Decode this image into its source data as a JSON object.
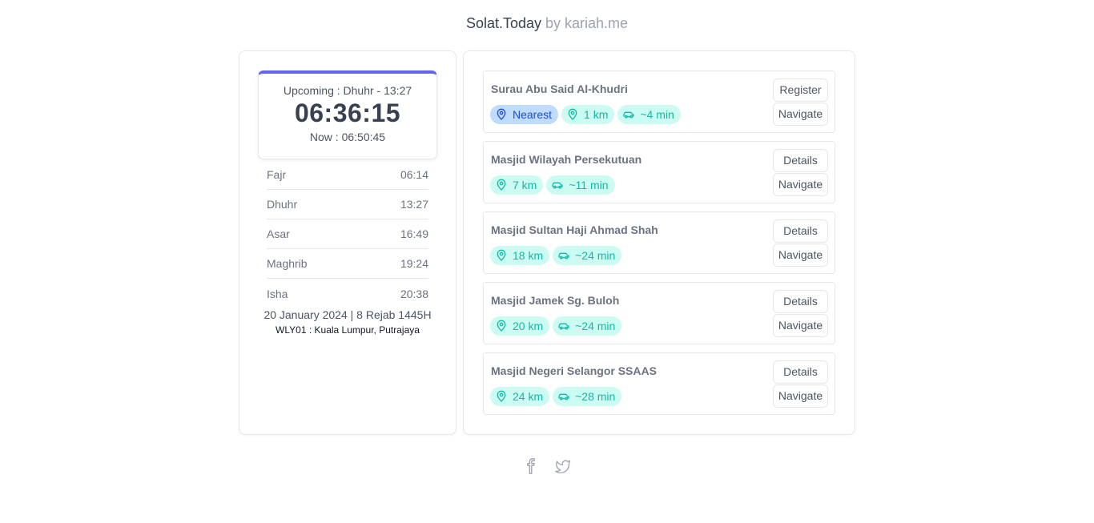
{
  "header": {
    "brand": "Solat.Today",
    "byline": "by kariah.me"
  },
  "countdown": {
    "upcoming": "Upcoming : Dhuhr - 13:27",
    "timer": "06:36:15",
    "now": "Now : 06:50:45"
  },
  "prayers": [
    {
      "name": "Fajr",
      "time": "06:14"
    },
    {
      "name": "Dhuhr",
      "time": "13:27"
    },
    {
      "name": "Asar",
      "time": "16:49"
    },
    {
      "name": "Maghrib",
      "time": "19:24"
    },
    {
      "name": "Isha",
      "time": "20:38"
    }
  ],
  "date_line": "20 January 2024 | 8 Rejab 1445H",
  "zone_line": "WLY01 : Kuala Lumpur, Putrajaya",
  "mosques": [
    {
      "name": "Surau Abu Said Al-Khudri",
      "nearest_label": "Nearest",
      "distance": "1 km",
      "drive": "~4 min",
      "primary_button": "Register",
      "navigate_button": "Navigate"
    },
    {
      "name": "Masjid Wilayah Persekutuan",
      "distance": "7 km",
      "drive": "~11 min",
      "primary_button": "Details",
      "navigate_button": "Navigate"
    },
    {
      "name": "Masjid Sultan Haji Ahmad Shah",
      "distance": "18 km",
      "drive": "~24 min",
      "primary_button": "Details",
      "navigate_button": "Navigate"
    },
    {
      "name": "Masjid Jamek Sg. Buloh",
      "distance": "20 km",
      "drive": "~24 min",
      "primary_button": "Details",
      "navigate_button": "Navigate"
    },
    {
      "name": "Masjid Negeri Selangor SSAAS",
      "distance": "24 km",
      "drive": "~28 min",
      "primary_button": "Details",
      "navigate_button": "Navigate"
    }
  ],
  "footer": {
    "icons": [
      "facebook-icon",
      "twitter-icon"
    ]
  },
  "colors": {
    "accent": "#6366f1",
    "teal_bg": "#ccfbf1",
    "teal_fg": "#14b8a6",
    "blue_bg": "#bfdbfe",
    "blue_fg": "#1d4ed8"
  }
}
